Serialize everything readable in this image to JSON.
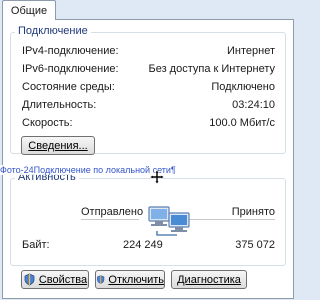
{
  "tab": {
    "label": "Общие"
  },
  "connection": {
    "legend": "Подключение",
    "rows": [
      {
        "label": "IPv4-подключение:",
        "value": "Интернет"
      },
      {
        "label": "IPv6-подключение:",
        "value": "Без доступа к Интернету"
      },
      {
        "label": "Состояние среды:",
        "value": "Подключено"
      },
      {
        "label": "Длительность:",
        "value": "03:24:10"
      },
      {
        "label": "Скорость:",
        "value": "100.0 Мбит/с"
      }
    ],
    "details_button": "Сведения..."
  },
  "activity": {
    "legend": "Активность",
    "sent_label": "Отправлено",
    "received_label": "Принято",
    "bytes_label": "Байт:",
    "bytes_sent": "224 249",
    "bytes_received": "375 072"
  },
  "overlay": {
    "text": "Фото-24Подключение по локальной сети¶"
  },
  "buttons": {
    "properties": "Свойства",
    "disable": "Отключить",
    "diagnose": "Диагностика"
  },
  "colors": {
    "accent": "#1e3a7a",
    "background": "#dfe9f5"
  }
}
